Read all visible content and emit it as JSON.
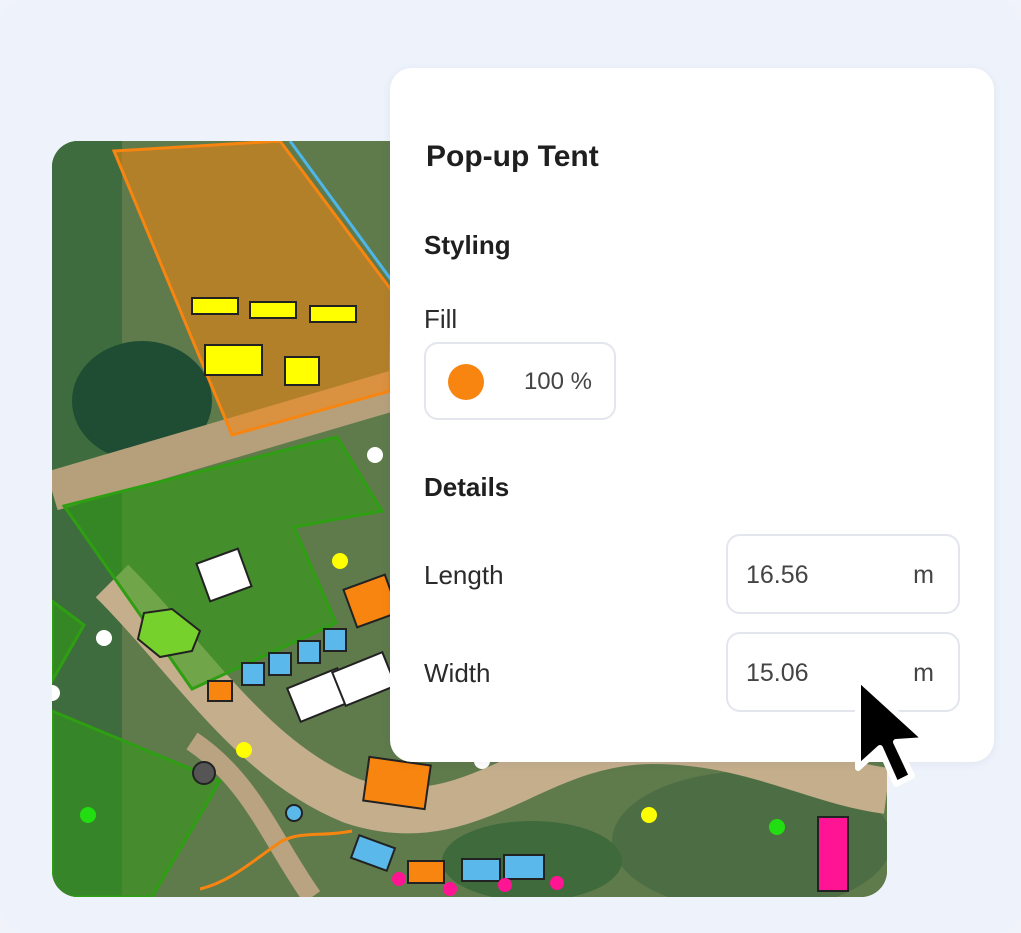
{
  "panel": {
    "title": "Pop-up Tent",
    "styling_heading": "Styling",
    "fill_label": "Fill",
    "fill_color": "#f7850f",
    "fill_opacity": "100 %",
    "details_heading": "Details",
    "length_label": "Length",
    "length_value": "16.56",
    "length_unit": "m",
    "width_label": "Width",
    "width_value": "15.06",
    "width_unit": "m"
  },
  "map": {
    "colors": {
      "zone_orange": "#f7850f",
      "zone_green": "#2e9e12",
      "tent_yellow": "#ffff00",
      "tent_blue": "#5ab8ea",
      "tent_orange": "#f7850f",
      "tent_white": "#ffffff",
      "vehicle_pink": "#ff1493",
      "marker_yellow": "#ffff00",
      "marker_white": "#ffffff",
      "marker_green": "#22dd11",
      "marker_pink": "#ff1493",
      "boundary_blue": "#4fb6ea"
    }
  }
}
